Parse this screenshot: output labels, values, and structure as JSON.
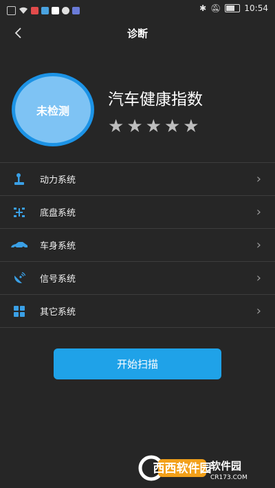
{
  "status_bar": {
    "time": "10:54"
  },
  "header": {
    "back_icon": "chevron-left-icon",
    "title": "诊断"
  },
  "score": {
    "status": "未检测",
    "title": "汽车健康指数",
    "stars_total": 5,
    "stars_filled": 0
  },
  "systems": [
    {
      "label": "动力系统",
      "icon": "gear-shift-icon"
    },
    {
      "label": "底盘系统",
      "icon": "chassis-icon"
    },
    {
      "label": "车身系统",
      "icon": "car-body-icon"
    },
    {
      "label": "信号系统",
      "icon": "satellite-dish-icon"
    },
    {
      "label": "其它系统",
      "icon": "grid-icon"
    }
  ],
  "scan_button": {
    "label": "开始扫描"
  },
  "watermark": {
    "brand": "西西软件园",
    "domain": "CR173.COM"
  },
  "colors": {
    "accent": "#1fa2e8",
    "background": "#262626",
    "star": "#bdbdbd",
    "circle_inner": "#7ec3f4",
    "circle_outer": "#1c93e6"
  }
}
